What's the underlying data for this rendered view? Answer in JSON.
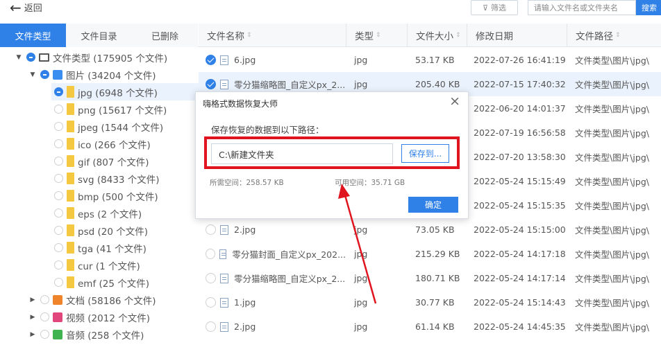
{
  "topbar": {
    "back_label": "返回",
    "filter_label": "筛选",
    "search_placeholder": "请输入文件名或文件夹名",
    "search_label": "搜索"
  },
  "tabs": [
    {
      "label": "文件类型",
      "active": true
    },
    {
      "label": "文件目录",
      "active": false
    },
    {
      "label": "已删除",
      "active": false
    }
  ],
  "tree": [
    {
      "label": "文件类型 (175905 个文件)",
      "icon": "computer-icon",
      "expanded": true
    },
    {
      "label": "图片 (34204 个文件)",
      "icon": "image-icon",
      "expanded": true
    },
    {
      "label": "jpg (6948 个文件)",
      "icon": "folder-icon",
      "selected": true
    },
    {
      "label": "png (15617 个文件)",
      "icon": "folder-icon"
    },
    {
      "label": "jpeg (1544 个文件)",
      "icon": "folder-icon"
    },
    {
      "label": "ico (266 个文件)",
      "icon": "folder-icon"
    },
    {
      "label": "gif (807 个文件)",
      "icon": "folder-icon"
    },
    {
      "label": "svg (8433 个文件)",
      "icon": "folder-icon"
    },
    {
      "label": "bmp (500 个文件)",
      "icon": "folder-icon"
    },
    {
      "label": "eps (2 个文件)",
      "icon": "folder-icon"
    },
    {
      "label": "psd (20 个文件)",
      "icon": "folder-icon"
    },
    {
      "label": "tga (41 个文件)",
      "icon": "folder-icon"
    },
    {
      "label": "cur (1 个文件)",
      "icon": "folder-icon"
    },
    {
      "label": "emf (25 个文件)",
      "icon": "folder-icon"
    },
    {
      "label": "文档 (58186 个文件)",
      "icon": "document-icon",
      "expanded": false
    },
    {
      "label": "视频 (2012 个文件)",
      "icon": "video-icon",
      "expanded": false
    },
    {
      "label": "音频 (258 个文件)",
      "icon": "audio-icon",
      "expanded": false
    }
  ],
  "table": {
    "headers": [
      "文件名称",
      "类型",
      "文件大小",
      "修改日期",
      "文件路径"
    ],
    "rows": [
      {
        "name": "6.jpg",
        "type": "jpg",
        "size": "53.17 KB",
        "date": "2022-07-26 16:41:19",
        "path": "文件类型\\图片\\jpg\\",
        "checked": true
      },
      {
        "name": "零分猫缩略图_自定义px_2...",
        "type": "jpg",
        "size": "205.40 KB",
        "date": "2022-07-15 17:40:32",
        "path": "文件类型\\图片\\jpg\\",
        "checked": true,
        "selected": true
      },
      {
        "name": "",
        "type": "",
        "size": "",
        "date": "2022-06-20 14:01:37",
        "path": "文件类型\\图片\\jpg\\"
      },
      {
        "name": "",
        "type": "",
        "size": "",
        "date": "2022-07-19 16:56:58",
        "path": "文件类型\\图片\\jpg\\"
      },
      {
        "name": "",
        "type": "",
        "size": "",
        "date": "2022-07-20 13:58:30",
        "path": "文件类型\\图片\\jpg\\"
      },
      {
        "name": "",
        "type": "",
        "size": "",
        "date": "2022-05-24 15:15:49",
        "path": "文件类型\\图片\\jpg\\"
      },
      {
        "name": "",
        "type": "",
        "size": "",
        "date": "2022-05-24 15:15:35",
        "path": "文件类型\\图片\\jpg\\"
      },
      {
        "name": "2.jpg",
        "type": "jpg",
        "size": "73.05 KB",
        "date": "2022-05-24 15:15:00",
        "path": "文件类型\\图片\\jpg\\"
      },
      {
        "name": "零分猫封面_自定义px_202...",
        "type": "jpg",
        "size": "215.29 KB",
        "date": "2022-05-24 14:17:18",
        "path": "文件类型\\图片\\jpg\\"
      },
      {
        "name": "零分猫缩略图_自定义px_2...",
        "type": "jpg",
        "size": "180.71 KB",
        "date": "2022-05-24 14:17:14",
        "path": "文件类型\\图片\\jpg\\"
      },
      {
        "name": "1.jpg",
        "type": "jpg",
        "size": "30.77 KB",
        "date": "2022-05-24 15:14:43",
        "path": "文件类型\\图片\\jpg\\"
      },
      {
        "name": "2.jpg",
        "type": "jpg",
        "size": "61.14 KB",
        "date": "2022-05-24 14:45:35",
        "path": "文件类型\\图片\\jpg\\"
      }
    ]
  },
  "modal": {
    "title": "嗨格式数据恢复大师",
    "close": "×",
    "label": "保存恢复的数据到以下路径：",
    "path_value": "C:\\新建文件夹",
    "save_to_label": "保存到...",
    "space_needed": "所需空间：258.57 KB",
    "space_free": "可用空间：35.71 GB",
    "ok_label": "确定"
  },
  "colors": {
    "accent": "#2f80e7",
    "highlight": "#e0141e",
    "selected_row": "#eaf2fd"
  }
}
